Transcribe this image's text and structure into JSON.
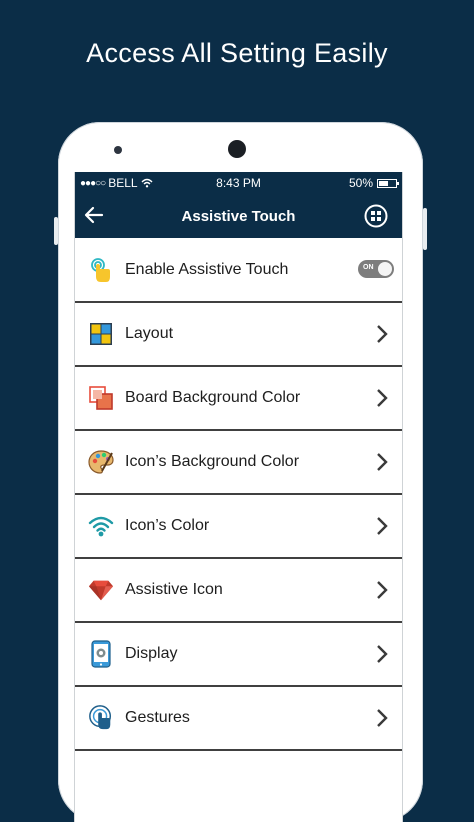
{
  "headline": "Access All Setting Easily",
  "status_bar": {
    "carrier": "BELL",
    "time": "8:43 PM",
    "battery": "50%"
  },
  "app_bar": {
    "title": "Assistive Touch"
  },
  "menu": {
    "items": [
      {
        "label": "Enable Assistive Touch",
        "icon": "touch-hand-icon",
        "control": "toggle",
        "toggle_text": "ON"
      },
      {
        "label": "Layout",
        "icon": "layout-grid-icon",
        "control": "chevron"
      },
      {
        "label": "Board Background Color",
        "icon": "board-color-icon",
        "control": "chevron"
      },
      {
        "label": "Icon’s Background Color",
        "icon": "palette-icon",
        "control": "chevron"
      },
      {
        "label": "Icon’s Color",
        "icon": "wifi-signal-icon",
        "control": "chevron"
      },
      {
        "label": "Assistive Icon",
        "icon": "ruby-gem-icon",
        "control": "chevron"
      },
      {
        "label": "Display",
        "icon": "phone-gear-icon",
        "control": "chevron"
      },
      {
        "label": "Gestures",
        "icon": "gesture-tap-icon",
        "control": "chevron"
      }
    ]
  },
  "colors": {
    "background": "#0b2d47",
    "app_bar": "#0b2d47",
    "divider": "#404040",
    "toggle_track": "#7d7d7d"
  }
}
